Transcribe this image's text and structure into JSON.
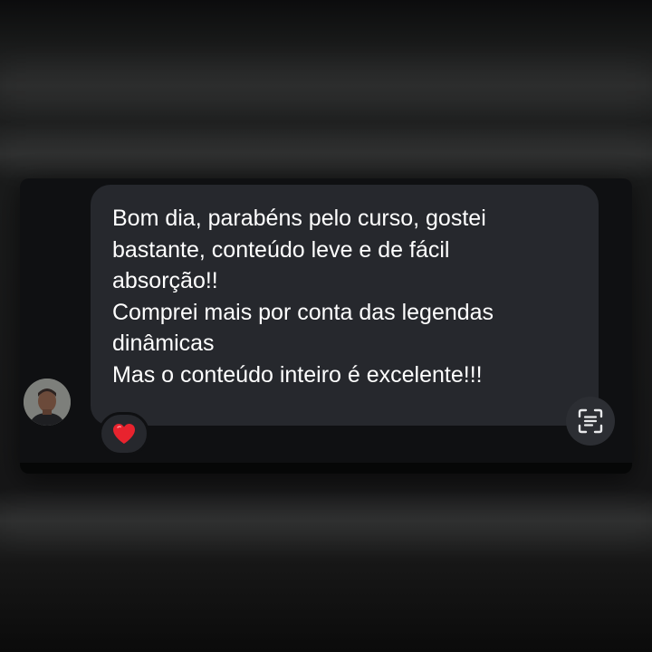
{
  "message": {
    "lines": [
      "Bom dia, parabéns pelo curso, gostei",
      "bastante, conteúdo leve e de fácil",
      "absorção!!",
      "Comprei mais por conta das legendas",
      "dinâmicas",
      "Mas o conteúdo inteiro é excelente!!!"
    ]
  },
  "reaction": {
    "icon": "heart-icon",
    "color": "#e8232e"
  },
  "actions": {
    "scan_icon": "text-scan-icon"
  },
  "colors": {
    "bubble": "#26282d",
    "card": "#0f1012",
    "text": "#ffffff"
  }
}
